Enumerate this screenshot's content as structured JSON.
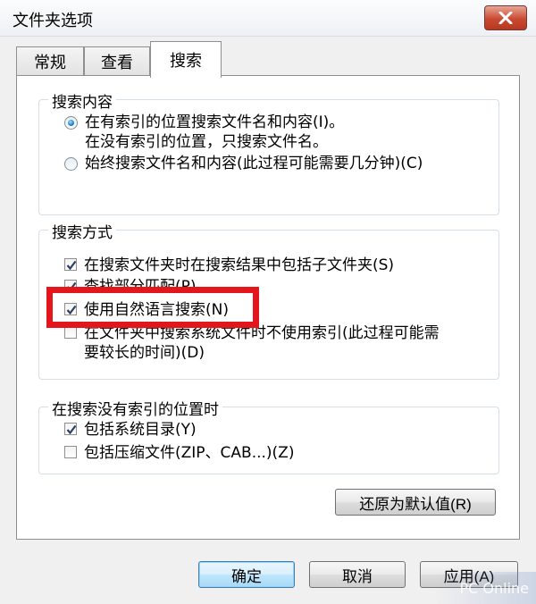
{
  "window": {
    "title": "文件夹选项"
  },
  "tabs": [
    {
      "label": "常规"
    },
    {
      "label": "查看"
    },
    {
      "label": "搜索"
    }
  ],
  "search_content": {
    "title": "搜索内容",
    "option1": {
      "line1": "在有索引的位置搜索文件名和内容(I)。",
      "line2": "在没有索引的位置，只搜索文件名。",
      "selected": true
    },
    "option2": {
      "label": "始终搜索文件名和内容(此过程可能需要几分钟)(C)",
      "selected": false
    }
  },
  "search_method": {
    "title": "搜索方式",
    "items": [
      {
        "label": "在搜索文件夹时在搜索结果中包括子文件夹(S)",
        "checked": true
      },
      {
        "label": "查找部分匹配(P)",
        "checked": true
      },
      {
        "label": "使用自然语言搜索(N)",
        "checked": true
      },
      {
        "line1": "在文件夹中搜索系统文件时不使用索引(此过程可能需",
        "line2": "要较长的时间)(D)",
        "checked": false
      }
    ]
  },
  "unindexed": {
    "title": "在搜索没有索引的位置时",
    "items": [
      {
        "label": "包括系统目录(Y)",
        "checked": true
      },
      {
        "label": "包括压缩文件(ZIP、CAB...)(Z)",
        "checked": false
      }
    ]
  },
  "buttons": {
    "restore": "还原为默认值(R)",
    "ok": "确定",
    "cancel": "取消",
    "apply": "应用(A)"
  },
  "watermark": {
    "text": "PC Online"
  },
  "colors": {
    "highlight": "#e4161b",
    "close": "#c94a33"
  }
}
